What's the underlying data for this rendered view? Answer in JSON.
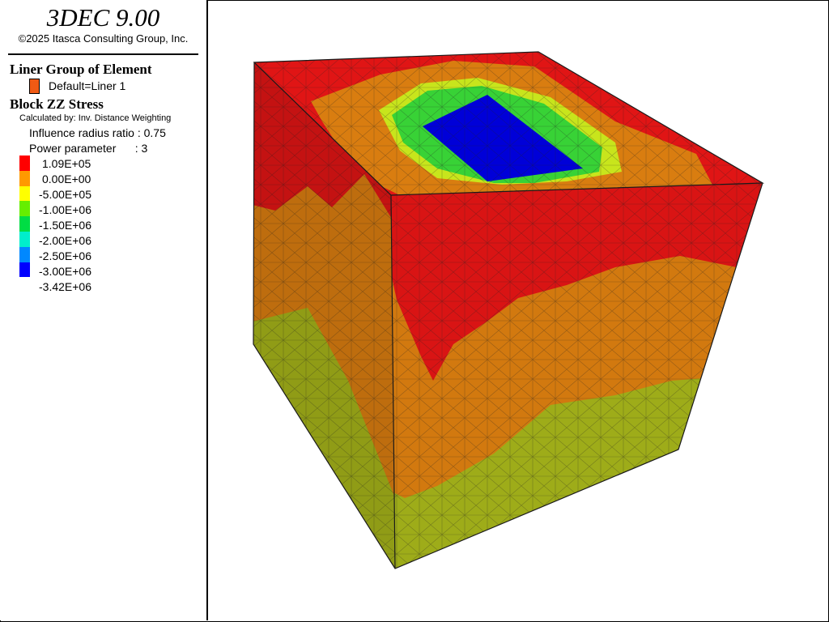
{
  "header": {
    "app_title": "3DEC 9.00",
    "copyright": "©2025 Itasca Consulting Group, Inc."
  },
  "legend": {
    "liner_heading": "Liner Group of Element",
    "liner_item": {
      "label": "Default=Liner 1",
      "color": "#f05a14"
    },
    "contour_heading": "Block  ZZ Stress",
    "calculated_by": "Calculated by: Inv. Distance Weighting",
    "influence_radius": "Influence radius ratio : 0.75",
    "power_parameter": "Power parameter      : 3",
    "scale": [
      {
        "label": "1.09E+05",
        "color": "#ff0000"
      },
      {
        "label": "0.00E+00",
        "color": "#ff9900"
      },
      {
        "label": "-5.00E+05",
        "color": "#ffff00"
      },
      {
        "label": "-1.00E+06",
        "color": "#66ee00"
      },
      {
        "label": "-1.50E+06",
        "color": "#00dd44"
      },
      {
        "label": "-2.00E+06",
        "color": "#00eecc"
      },
      {
        "label": "-2.50E+06",
        "color": "#0088ff"
      },
      {
        "label": "-3.00E+06",
        "color": "#0000ff"
      },
      {
        "label": "-3.42E+06",
        "color": null
      }
    ]
  },
  "model": {
    "colors": {
      "red": "#e01515",
      "orange": "#d97d10",
      "olive": "#a4b21a",
      "yellowgreen": "#c8e51c",
      "green": "#38d236",
      "blue": "#0000d8"
    }
  }
}
